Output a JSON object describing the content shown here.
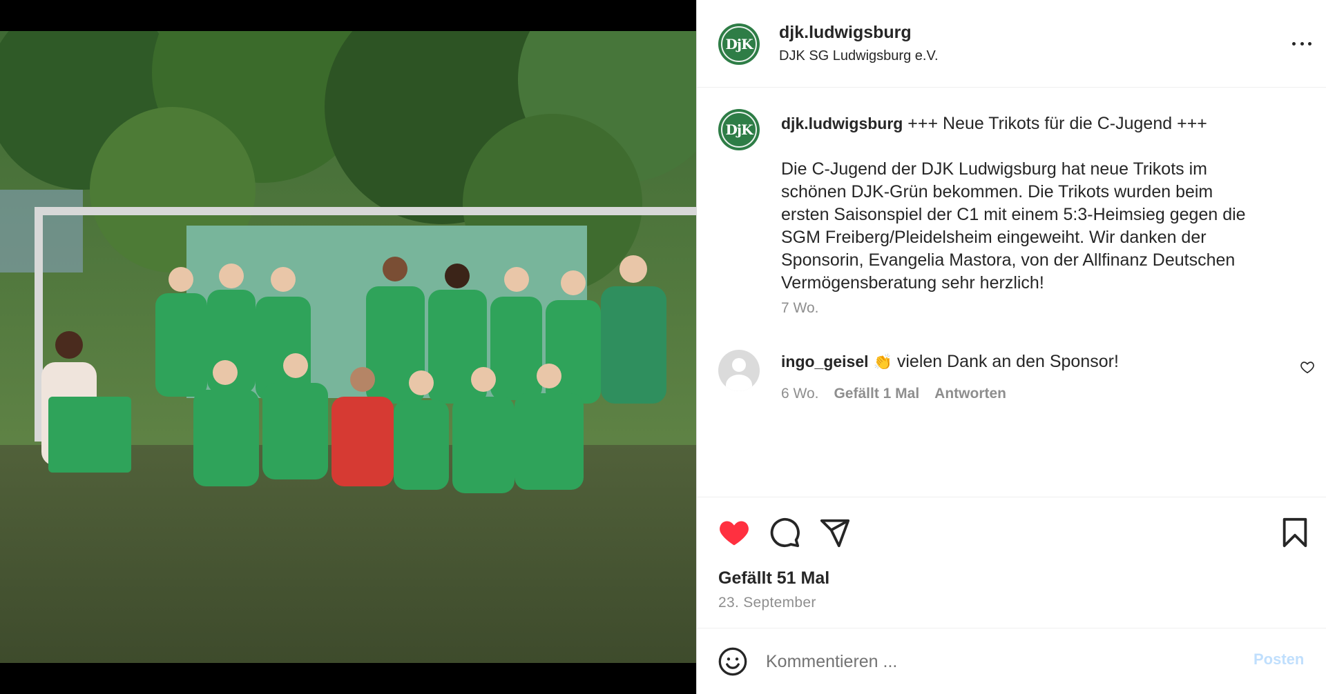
{
  "post": {
    "username": "djk.ludwigsburg",
    "subtitle": "DJK SG Ludwigsburg e.V.",
    "avatar_text": "DjK",
    "caption": {
      "username": "djk.ludwigsburg",
      "headline": "+++ Neue Trikots für die C-Jugend +++",
      "body": "Die C-Jugend der DJK Ludwigsburg hat neue Trikots im\nschönen DJK-Grün bekommen. Die Trikots wurden beim\nersten Saisonspiel der C1 mit einem 5:3-Heimsieg gegen die\nSGM Freiberg/Pleidelsheim eingeweiht. Wir danken der\nSponsorin, Evangelia Mastora, von der Allfinanz Deutschen\nVermögensberatung sehr herzlich!",
      "time": "7 Wo."
    },
    "comments": [
      {
        "username": "ingo_geisel",
        "emoji": "👏",
        "text": "vielen Dank an den Sponsor!",
        "time": "6 Wo.",
        "likes": "Gefällt 1 Mal",
        "reply": "Antworten"
      }
    ],
    "likes": "Gefällt 51 Mal",
    "date": "23. September",
    "comment_placeholder": "Kommentieren ...",
    "post_button": "Posten"
  },
  "icons": {
    "like": "heart-filled-icon",
    "comment": "speech-bubble-icon",
    "share": "paper-plane-icon",
    "save": "bookmark-icon",
    "more": "more-horizontal-icon",
    "emoji": "smiley-icon"
  },
  "colors": {
    "like_red": "#ff3040",
    "brand_green": "#2e7d46",
    "muted": "#8e8e8e",
    "post_disabled": "#c0dffd"
  }
}
